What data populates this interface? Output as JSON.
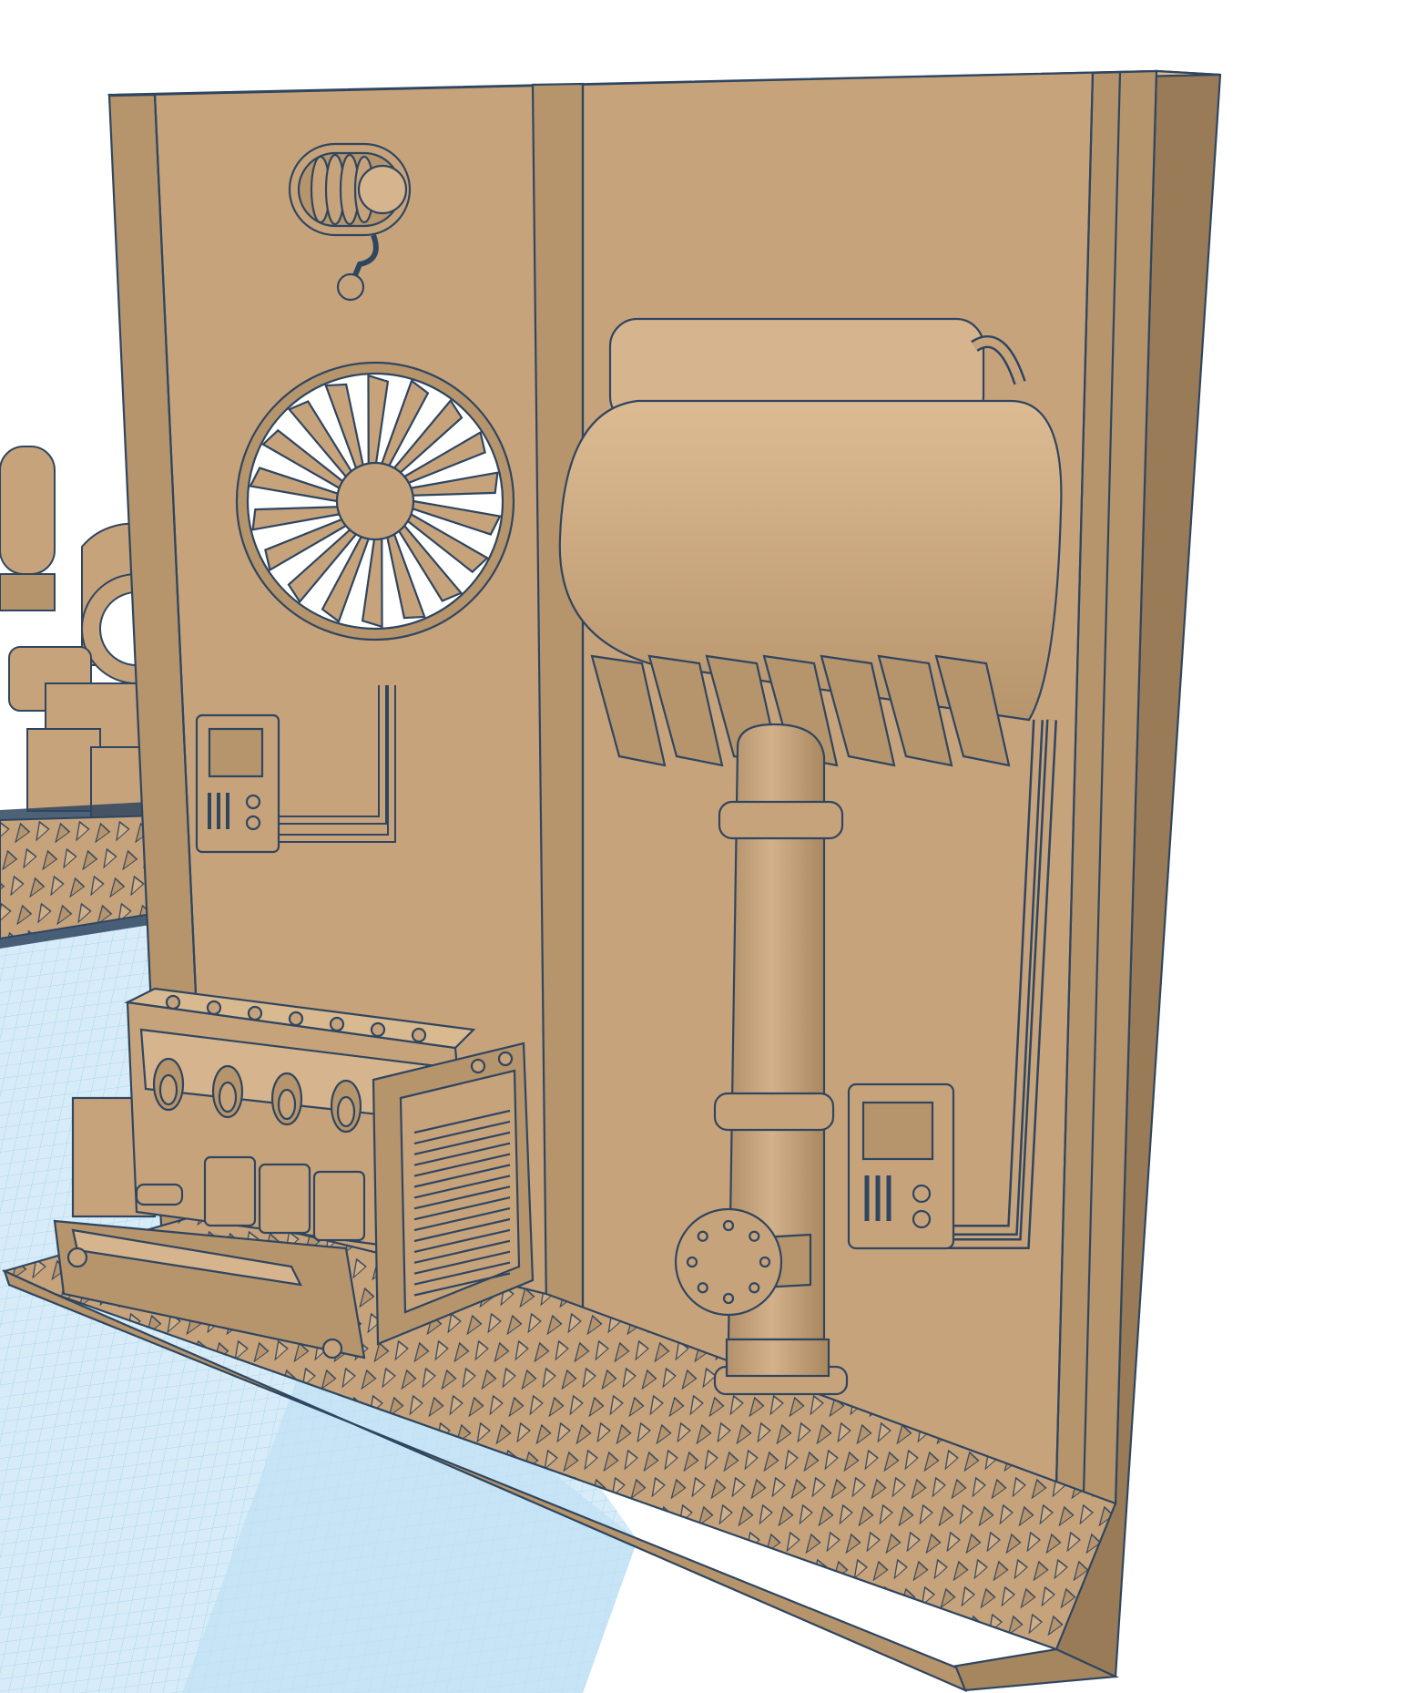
{
  "workplane": {
    "grid_color": "#9fd0ea",
    "fill_color": "#d7ecf8",
    "highlight_color": "#bfe1f4",
    "ruler_text": ""
  },
  "model": {
    "name": "",
    "colors": {
      "face": "#c7a37c",
      "face_light": "#d6b48d",
      "face_dark": "#a5865f",
      "side": "#9a7b58",
      "edge": "#2f4660",
      "void": "#ffffff"
    },
    "parts": {
      "back_wall": "wall-panel",
      "vent_icon": "exhaust-vent-icon",
      "fan_icon": "turbine-fan-icon",
      "control_panel_left": "control-panel-icon",
      "control_panel_right": "control-panel-icon",
      "engine_block": "engine-block-icon",
      "radiator_grille": "radiator-grille-icon",
      "tank": "tank-icon",
      "pipe": "pipe-icon",
      "flange": "flange-icon",
      "floor_plate": "diamond-plate-floor"
    }
  },
  "background_objects": {
    "left_assembly": "background-machinery-icon"
  }
}
